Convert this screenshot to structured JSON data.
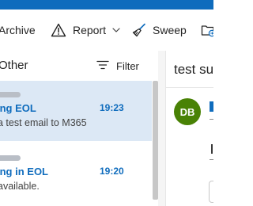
{
  "toolbar": {
    "archive_label": "Archive",
    "report_label": "Report",
    "sweep_label": "Sweep"
  },
  "message_list": {
    "tab_label": "Other",
    "filter_label": "Filter",
    "messages": [
      {
        "subject": "ing EOL",
        "time": "19:23",
        "preview": "a test email to M365",
        "selected": true
      },
      {
        "subject": "ing in EOL",
        "time": "19:20",
        "preview": "available.",
        "selected": false
      }
    ]
  },
  "reading_pane": {
    "subject": "test su",
    "avatar_initials": "DB"
  },
  "colors": {
    "accent": "#0f6cbd",
    "selected_row": "#dce8f5",
    "avatar": "#498205"
  }
}
